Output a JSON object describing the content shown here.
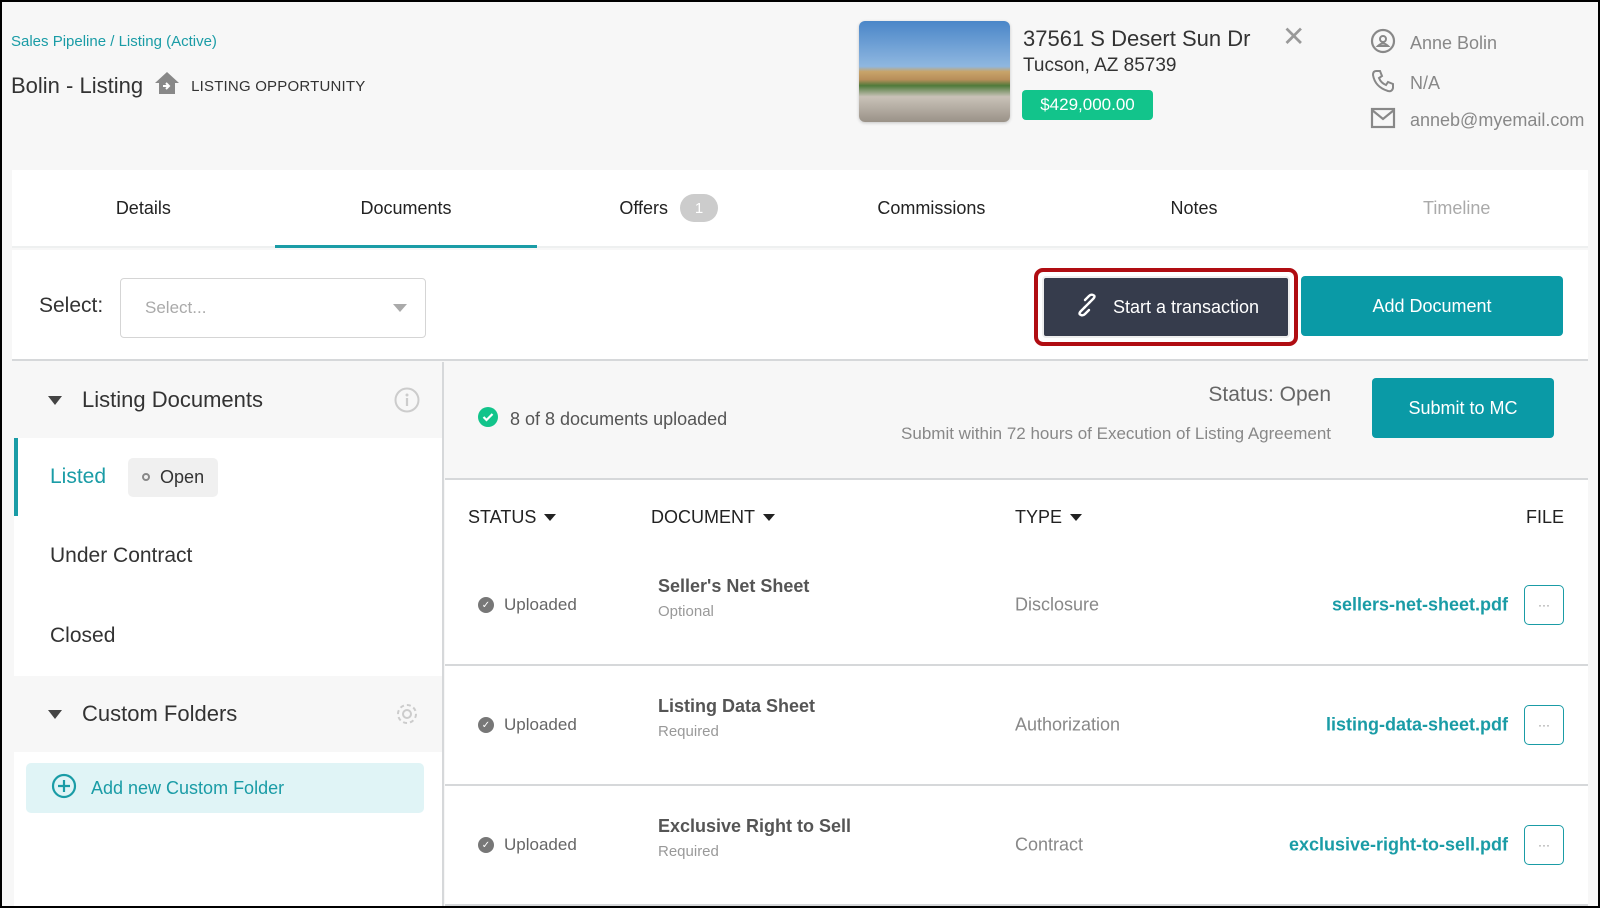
{
  "header": {
    "breadcrumb": "Sales Pipeline / Listing (Active)",
    "title": "Bolin - Listing",
    "type_label": "LISTING OPPORTUNITY",
    "icons": {
      "type": "house-arrow-icon",
      "close": "close-icon"
    }
  },
  "property": {
    "address_line1": "37561 S Desert Sun Dr",
    "address_line2": "Tucson, AZ 85739",
    "price": "$429,000.00",
    "price_color": "#12c48b"
  },
  "contact": {
    "name": "Anne Bolin",
    "phone": "N/A",
    "email": "anneb@myemail.com"
  },
  "tabs": [
    {
      "label": "Details"
    },
    {
      "label": "Documents",
      "active": true
    },
    {
      "label": "Offers",
      "badge": "1"
    },
    {
      "label": "Commissions"
    },
    {
      "label": "Notes"
    },
    {
      "label": "Timeline",
      "disabled": true
    }
  ],
  "toolbar": {
    "select_label": "Select:",
    "select_placeholder": "Select...",
    "start_transaction": "Start a transaction",
    "add_document": "Add Document"
  },
  "sidebar": {
    "listing_documents": "Listing Documents",
    "items": [
      {
        "label": "Listed",
        "status": "Open",
        "active": true
      },
      {
        "label": "Under Contract"
      },
      {
        "label": "Closed"
      }
    ],
    "custom_folders": "Custom Folders",
    "add_folder": "Add new Custom Folder"
  },
  "status_panel": {
    "uploaded_summary": "8 of 8 documents uploaded",
    "status": "Status: Open",
    "deadline": "Submit within 72 hours of Execution of Listing Agreement",
    "submit": "Submit to MC"
  },
  "table": {
    "headers": {
      "status": "STATUS",
      "document": "DOCUMENT",
      "type": "TYPE",
      "file": "FILE"
    },
    "rows": [
      {
        "status": "Uploaded",
        "document": "Seller's Net Sheet",
        "requirement": "Optional",
        "type": "Disclosure",
        "file": "sellers-net-sheet.pdf",
        "more": "···"
      },
      {
        "status": "Uploaded",
        "document": "Listing Data Sheet",
        "requirement": "Required",
        "type": "Authorization",
        "file": "listing-data-sheet.pdf",
        "more": "···"
      },
      {
        "status": "Uploaded",
        "document": "Exclusive Right to Sell",
        "requirement": "Required",
        "type": "Contract",
        "file": "exclusive-right-to-sell.pdf",
        "more": "···"
      }
    ]
  },
  "colors": {
    "accent": "#0a9aa6",
    "dark_button": "#363c4c",
    "highlight": "#b00d12"
  }
}
